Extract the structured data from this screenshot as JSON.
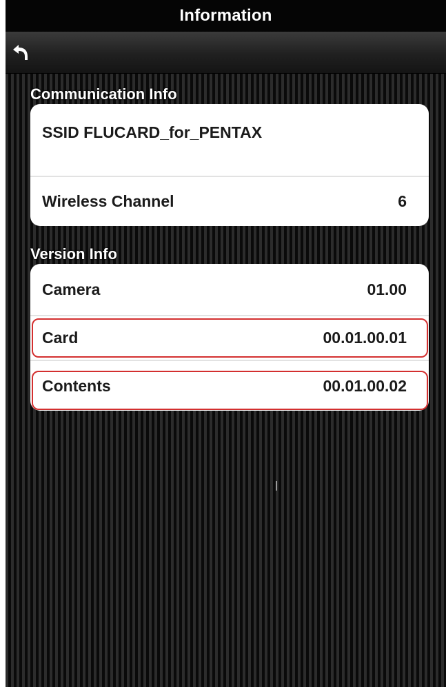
{
  "header": {
    "title": "Information"
  },
  "toolbar": {
    "back_icon": "back-arrow-icon"
  },
  "communication_info": {
    "section_label": "Communication Info",
    "ssid_label": "SSID FLUCARD_for_PENTAX",
    "wireless_channel_label": "Wireless Channel",
    "wireless_channel_value": "6"
  },
  "version_info": {
    "section_label": "Version Info",
    "rows": [
      {
        "label": "Camera",
        "value": "01.00"
      },
      {
        "label": "Card",
        "value": "00.01.00.01"
      },
      {
        "label": "Contents",
        "value": "00.01.00.02"
      }
    ]
  },
  "colors": {
    "highlight": "#d32f2f",
    "card_background": "#ffffff",
    "title_bar_background": "#050505"
  }
}
